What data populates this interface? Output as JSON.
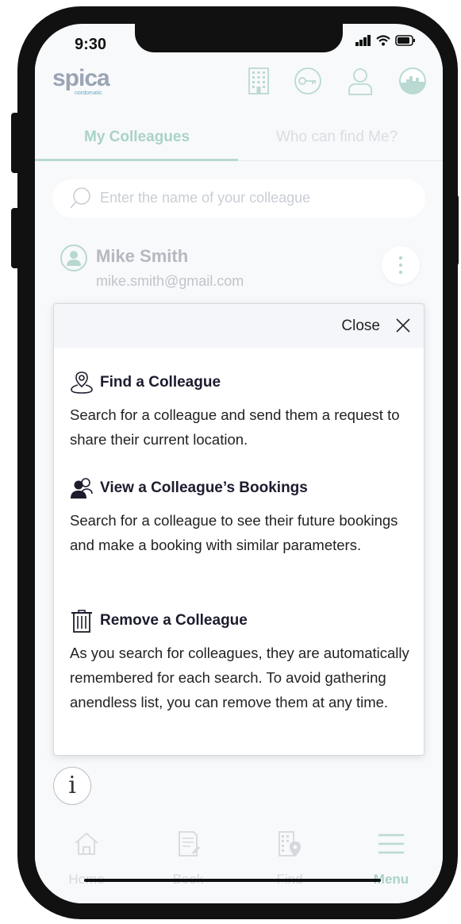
{
  "status_bar": {
    "time": "9:30"
  },
  "header": {
    "logo_text": "spica",
    "logo_sub": "nordomatic",
    "icons": [
      "building-icon",
      "key-icon",
      "user-icon",
      "profile-circle-icon"
    ]
  },
  "tabs": [
    {
      "label": "My Colleagues",
      "active": true
    },
    {
      "label": "Who can find Me?",
      "active": false
    }
  ],
  "search": {
    "placeholder": "Enter the name of your colleague"
  },
  "colleague": {
    "name": "Mike Smith",
    "email": "mike.smith@gmail.com"
  },
  "popup": {
    "close_label": "Close",
    "sections": [
      {
        "title": "Find a Colleague",
        "icon": "location-person-icon",
        "body": "Search for a colleague and send them a request to share their current location."
      },
      {
        "title": "View a Colleague’s Bookings",
        "icon": "people-icon",
        "body": "Search for a colleague to see their future bookings and make a booking with similar parameters."
      },
      {
        "title": "Remove a Colleague",
        "icon": "trash-icon",
        "body": "As you search for colleagues, they are automatically remembered for each search. To avoid gathering anendless list, you can remove them at any time."
      }
    ]
  },
  "info_button": {
    "label": "i"
  },
  "bottom_nav": [
    {
      "label": "Home",
      "icon": "home-icon",
      "active": false
    },
    {
      "label": "Book",
      "icon": "book-icon",
      "active": false
    },
    {
      "label": "Find",
      "icon": "find-building-icon",
      "active": false
    },
    {
      "label": "Menu",
      "icon": "menu-icon",
      "active": true
    }
  ],
  "colors": {
    "accent": "#b9d9d2",
    "accent_text": "#a9d2c8",
    "muted": "#d5d8dd",
    "text": "#1c1c2e"
  }
}
